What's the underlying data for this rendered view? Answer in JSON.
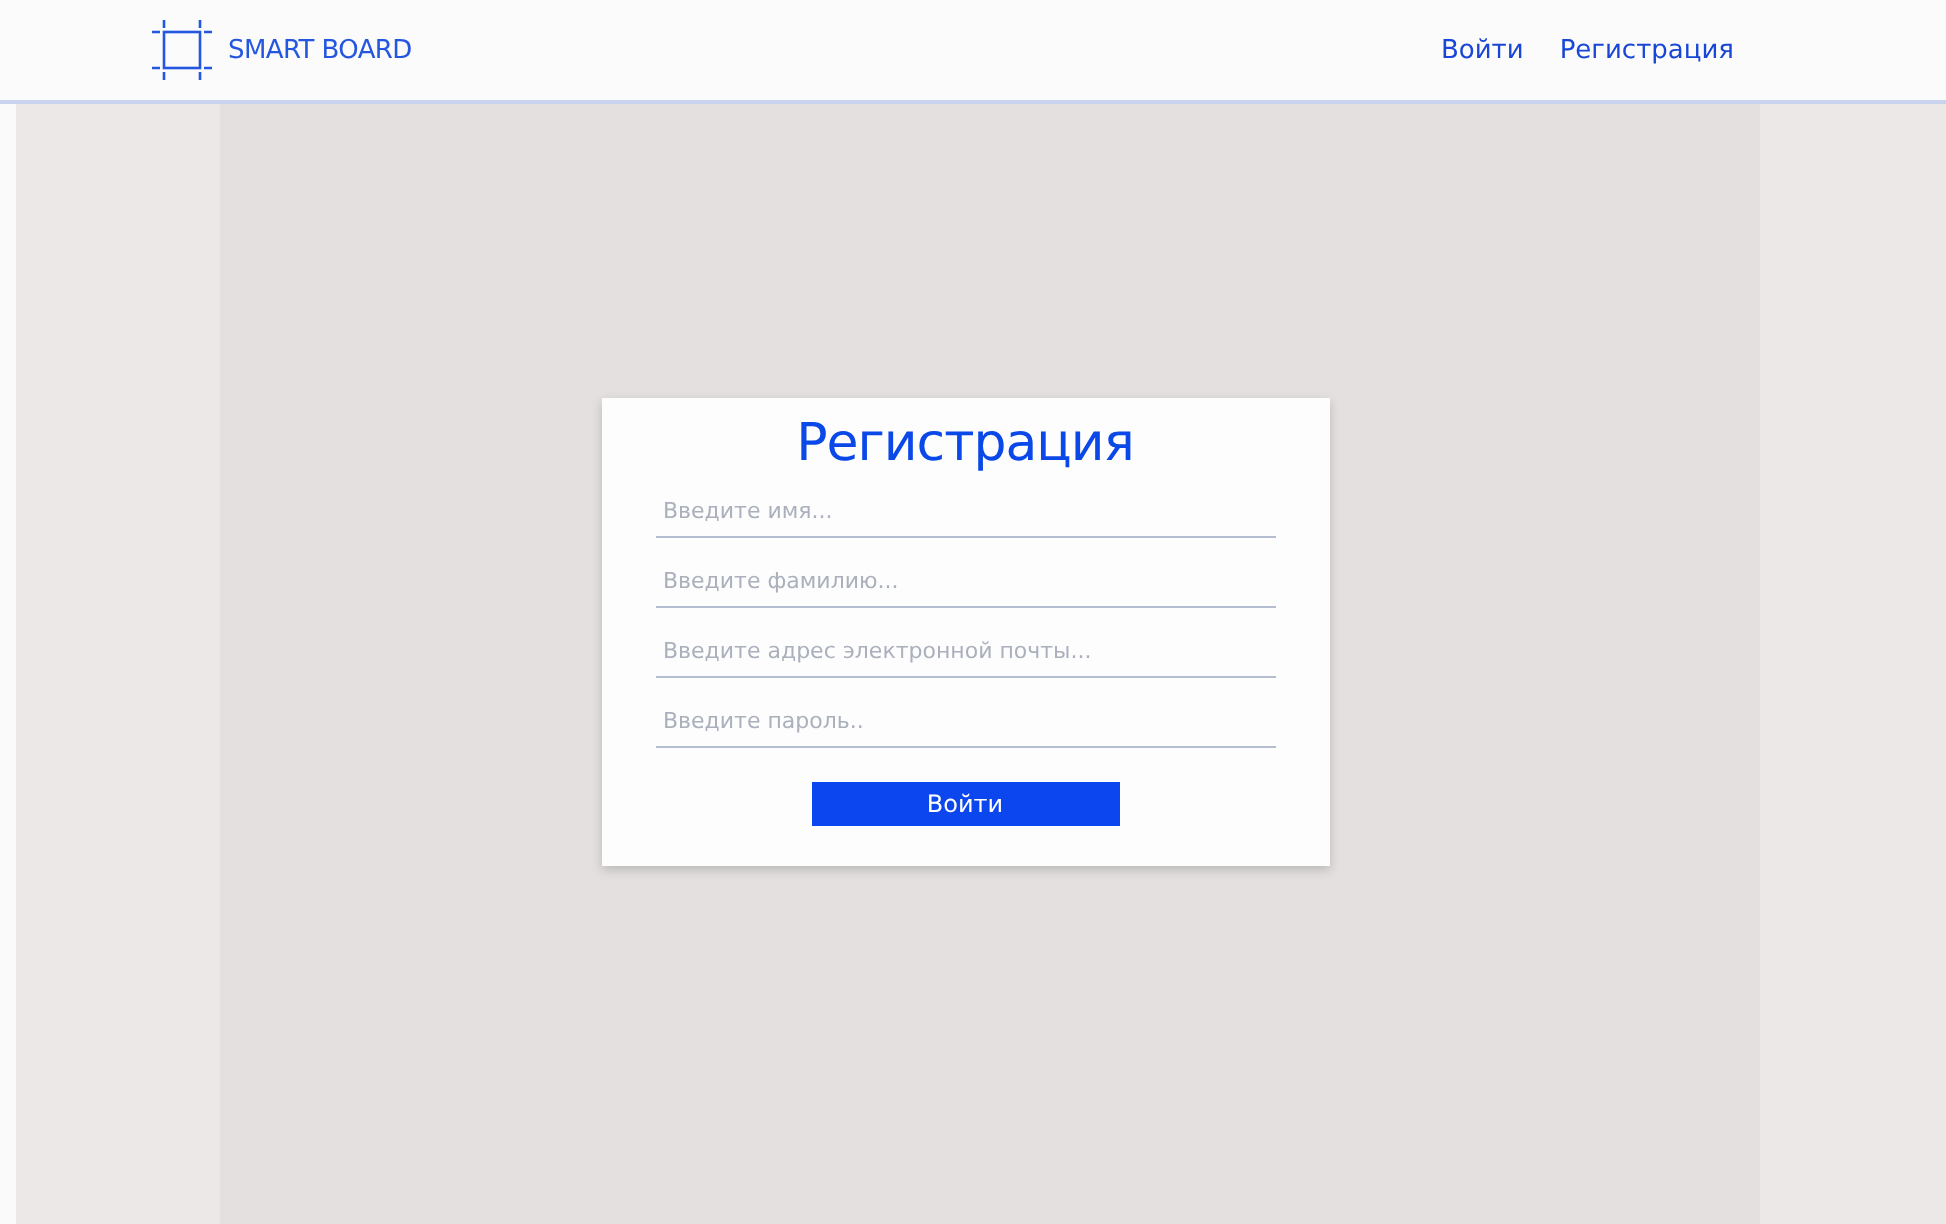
{
  "header": {
    "logo_text": "SMART BOARD",
    "nav": [
      {
        "label": "Войти"
      },
      {
        "label": "Регистрация"
      }
    ]
  },
  "form": {
    "title": "Регистрация",
    "fields": [
      {
        "placeholder": "Введите имя..."
      },
      {
        "placeholder": "Введите фамилию..."
      },
      {
        "placeholder": "Введите адрес электронной почты..."
      },
      {
        "placeholder": "Введите пароль.."
      }
    ],
    "submit": "Войти"
  }
}
